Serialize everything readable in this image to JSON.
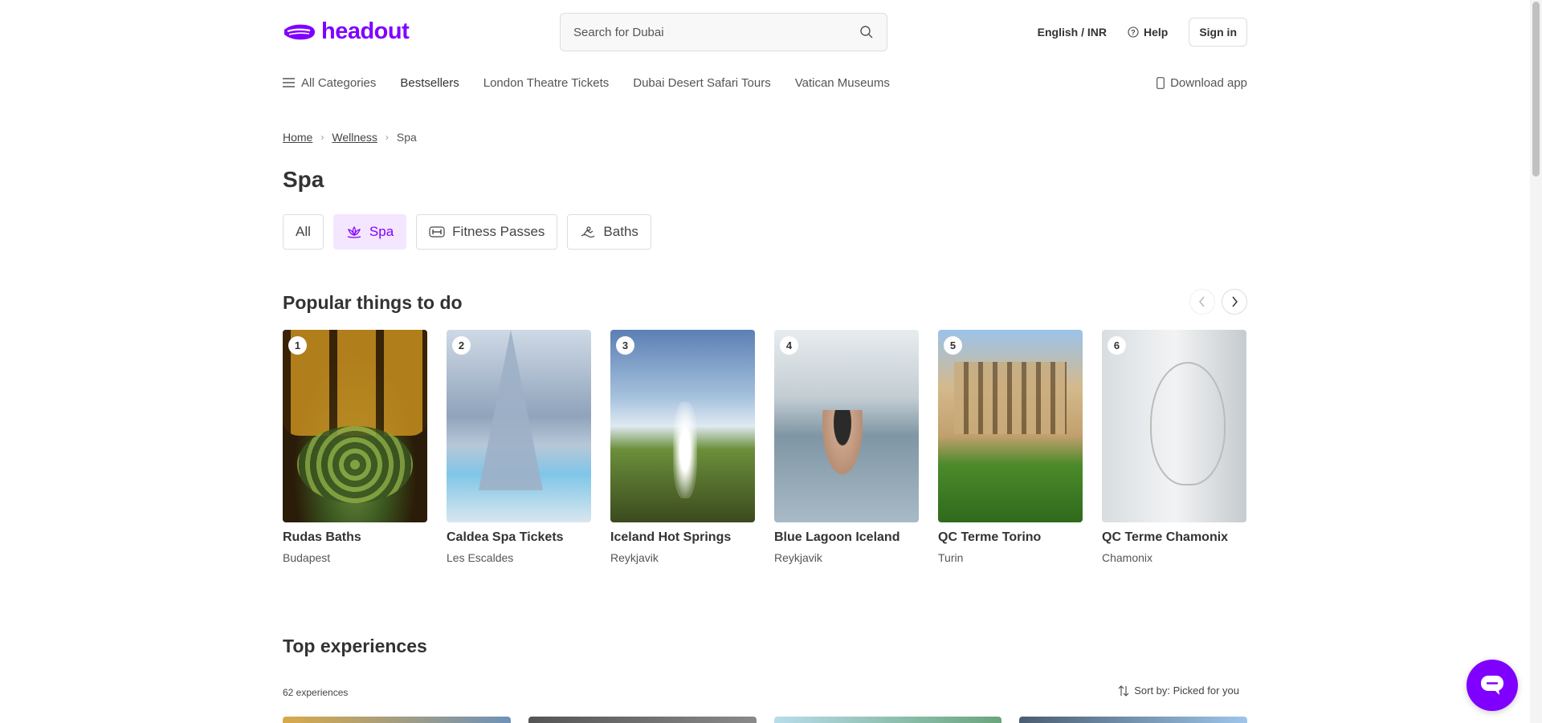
{
  "header": {
    "logo_text": "headout",
    "search": {
      "placeholder": "Search for Dubai"
    },
    "language_currency": "English / INR",
    "help_label": "Help",
    "signin_label": "Sign in"
  },
  "nav": {
    "all_categories": "All Categories",
    "items": [
      "Bestsellers",
      "London Theatre Tickets",
      "Dubai Desert Safari Tours",
      "Vatican Museums"
    ],
    "download_app": "Download app"
  },
  "breadcrumb": [
    "Home",
    "Wellness",
    "Spa"
  ],
  "page_title": "Spa",
  "chips": [
    {
      "label": "All",
      "active": false,
      "icon": ""
    },
    {
      "label": "Spa",
      "active": true,
      "icon": "lotus-icon"
    },
    {
      "label": "Fitness Passes",
      "active": false,
      "icon": "dumbbell-icon"
    },
    {
      "label": "Baths",
      "active": false,
      "icon": "bath-icon"
    }
  ],
  "popular": {
    "title": "Popular things to do",
    "cards": [
      {
        "rank": "1",
        "name": "Rudas Baths",
        "city": "Budapest"
      },
      {
        "rank": "2",
        "name": "Caldea Spa Tickets",
        "city": "Les Escaldes"
      },
      {
        "rank": "3",
        "name": "Iceland Hot Springs",
        "city": "Reykjavik"
      },
      {
        "rank": "4",
        "name": "Blue Lagoon Iceland",
        "city": "Reykjavik"
      },
      {
        "rank": "5",
        "name": "QC Terme Torino",
        "city": "Turin"
      },
      {
        "rank": "6",
        "name": "QC Terme Chamonix",
        "city": "Chamonix"
      }
    ]
  },
  "top": {
    "title": "Top experiences",
    "count": "62 experiences",
    "sort_label": "Sort by: Picked for you"
  },
  "colors": {
    "brand": "#8000ff",
    "chip_active_bg": "#f4e6ff"
  }
}
